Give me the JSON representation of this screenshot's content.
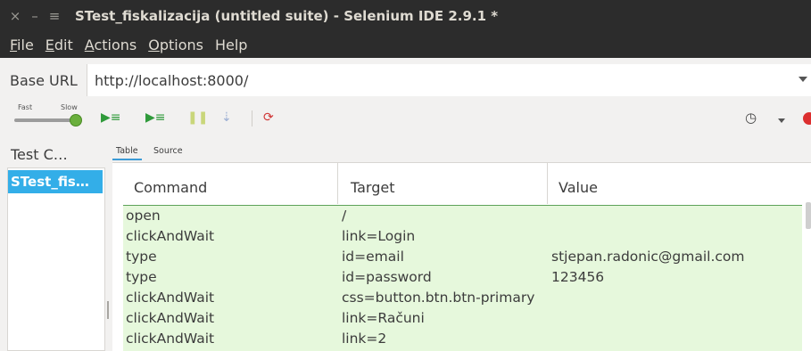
{
  "window": {
    "title": "STest_fiskalizacija (untitled suite) - Selenium IDE 2.9.1 *",
    "close_glyph": "×",
    "minimize_glyph": "–",
    "menu_glyph": "≡"
  },
  "menubar": [
    {
      "mnemonic": "F",
      "rest": "ile"
    },
    {
      "mnemonic": "E",
      "rest": "dit"
    },
    {
      "mnemonic": "A",
      "rest": "ctions"
    },
    {
      "mnemonic": "O",
      "rest": "ptions"
    },
    {
      "mnemonic": "",
      "rest": "Help"
    }
  ],
  "base_url": {
    "label": "Base URL",
    "value": "http://localhost:8000/"
  },
  "toolbar": {
    "speed_fast": "Fast",
    "speed_slow": "Slow",
    "speed_level": 1.0,
    "icons": [
      "play-all-icon",
      "play-current-icon",
      "pause-icon",
      "step-icon",
      "rollup-icon",
      "clock-icon",
      "record-icon"
    ]
  },
  "suite_panel": {
    "header": "Test C…",
    "items": [
      "STest_fis…"
    ]
  },
  "tabs": {
    "table": "Table",
    "source": "Source"
  },
  "table": {
    "headers": {
      "command": "Command",
      "target": "Target",
      "value": "Value"
    },
    "rows": [
      {
        "command": "open",
        "target": "/",
        "value": ""
      },
      {
        "command": "clickAndWait",
        "target": "link=Login",
        "value": ""
      },
      {
        "command": "type",
        "target": "id=email",
        "value": "stjepan.radonic@gmail.com"
      },
      {
        "command": "type",
        "target": "id=password",
        "value": "123456"
      },
      {
        "command": "clickAndWait",
        "target": "css=button.btn.btn-primary",
        "value": ""
      },
      {
        "command": "clickAndWait",
        "target": "link=Računi",
        "value": ""
      },
      {
        "command": "clickAndWait",
        "target": "link=2",
        "value": ""
      }
    ]
  },
  "colors": {
    "titlebar": "#2c2c2c",
    "selection": "#33aee8",
    "rows_bg": "#e6f8dc",
    "play": "#2f9a3a",
    "record": "#dc2f2f"
  }
}
